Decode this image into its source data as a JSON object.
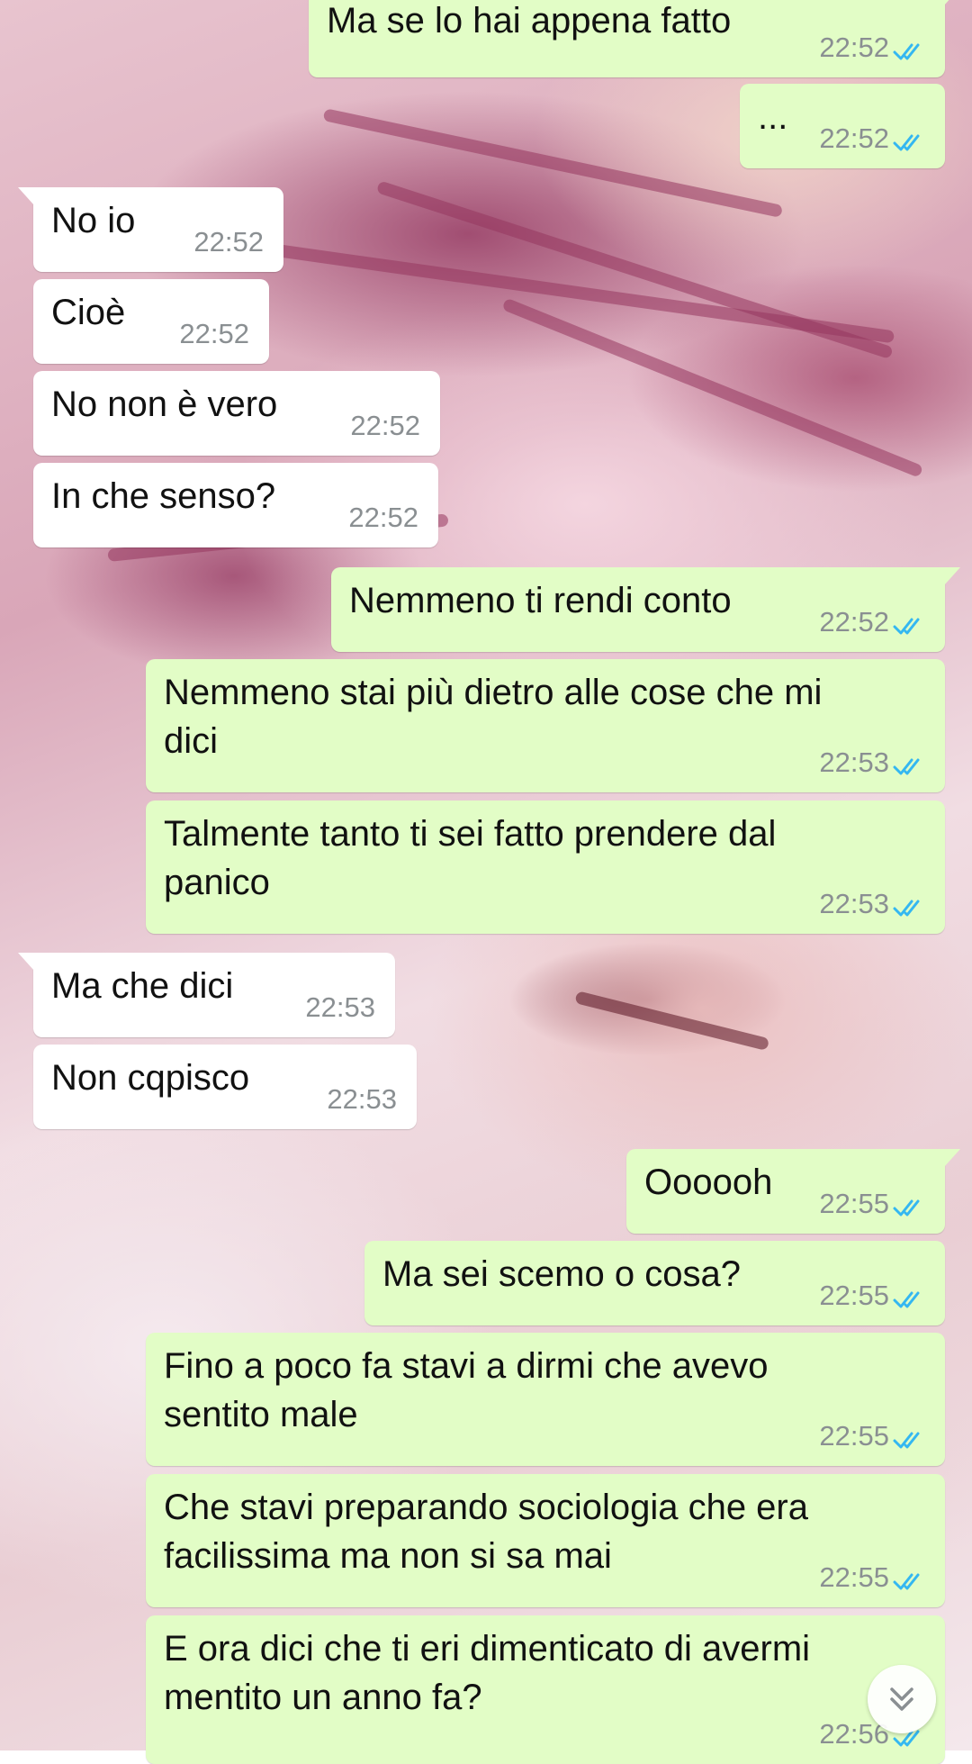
{
  "colors": {
    "outgoing_bubble": "#e2fdc6",
    "incoming_bubble": "#ffffff",
    "read_ticks": "#34b7f1",
    "timestamp": "#8a8f92"
  },
  "messages": [
    {
      "dir": "out",
      "lines": [
        "Ma se lo hai appena fatto"
      ],
      "time": "22:52",
      "status": "read"
    },
    {
      "dir": "out",
      "lines": [
        "..."
      ],
      "time": "22:52",
      "status": "read"
    },
    {
      "dir": "in",
      "lines": [
        "No io"
      ],
      "time": "22:52"
    },
    {
      "dir": "in",
      "lines": [
        "Cioè"
      ],
      "time": "22:52"
    },
    {
      "dir": "in",
      "lines": [
        "No non è vero"
      ],
      "time": "22:52"
    },
    {
      "dir": "in",
      "lines": [
        "In che senso?"
      ],
      "time": "22:52"
    },
    {
      "dir": "out",
      "lines": [
        "Nemmeno ti rendi conto"
      ],
      "time": "22:52",
      "status": "read"
    },
    {
      "dir": "out",
      "lines": [
        "Nemmeno stai più dietro alle cose che mi",
        "dici"
      ],
      "time": "22:53",
      "status": "read"
    },
    {
      "dir": "out",
      "lines": [
        "Talmente tanto ti sei fatto prendere dal",
        "panico"
      ],
      "time": "22:53",
      "status": "read"
    },
    {
      "dir": "in",
      "lines": [
        "Ma che dici"
      ],
      "time": "22:53"
    },
    {
      "dir": "in",
      "lines": [
        "Non cqpisco"
      ],
      "time": "22:53"
    },
    {
      "dir": "out",
      "lines": [
        "Oooooh"
      ],
      "time": "22:55",
      "status": "read"
    },
    {
      "dir": "out",
      "lines": [
        "Ma sei scemo o cosa?"
      ],
      "time": "22:55",
      "status": "read"
    },
    {
      "dir": "out",
      "lines": [
        "Fino a poco fa stavi a dirmi che avevo",
        "sentito male"
      ],
      "time": "22:55",
      "status": "read"
    },
    {
      "dir": "out",
      "lines": [
        "Che stavi preparando sociologia che era",
        "facilissima ma non si sa mai"
      ],
      "time": "22:55",
      "status": "read"
    },
    {
      "dir": "out",
      "lines": [
        "E ora dici che ti eri dimenticato di avermi",
        "mentito un anno fa?"
      ],
      "time": "22:56",
      "status": "read"
    }
  ],
  "scroll_button": {
    "icon": "double-chevron-down-icon"
  }
}
